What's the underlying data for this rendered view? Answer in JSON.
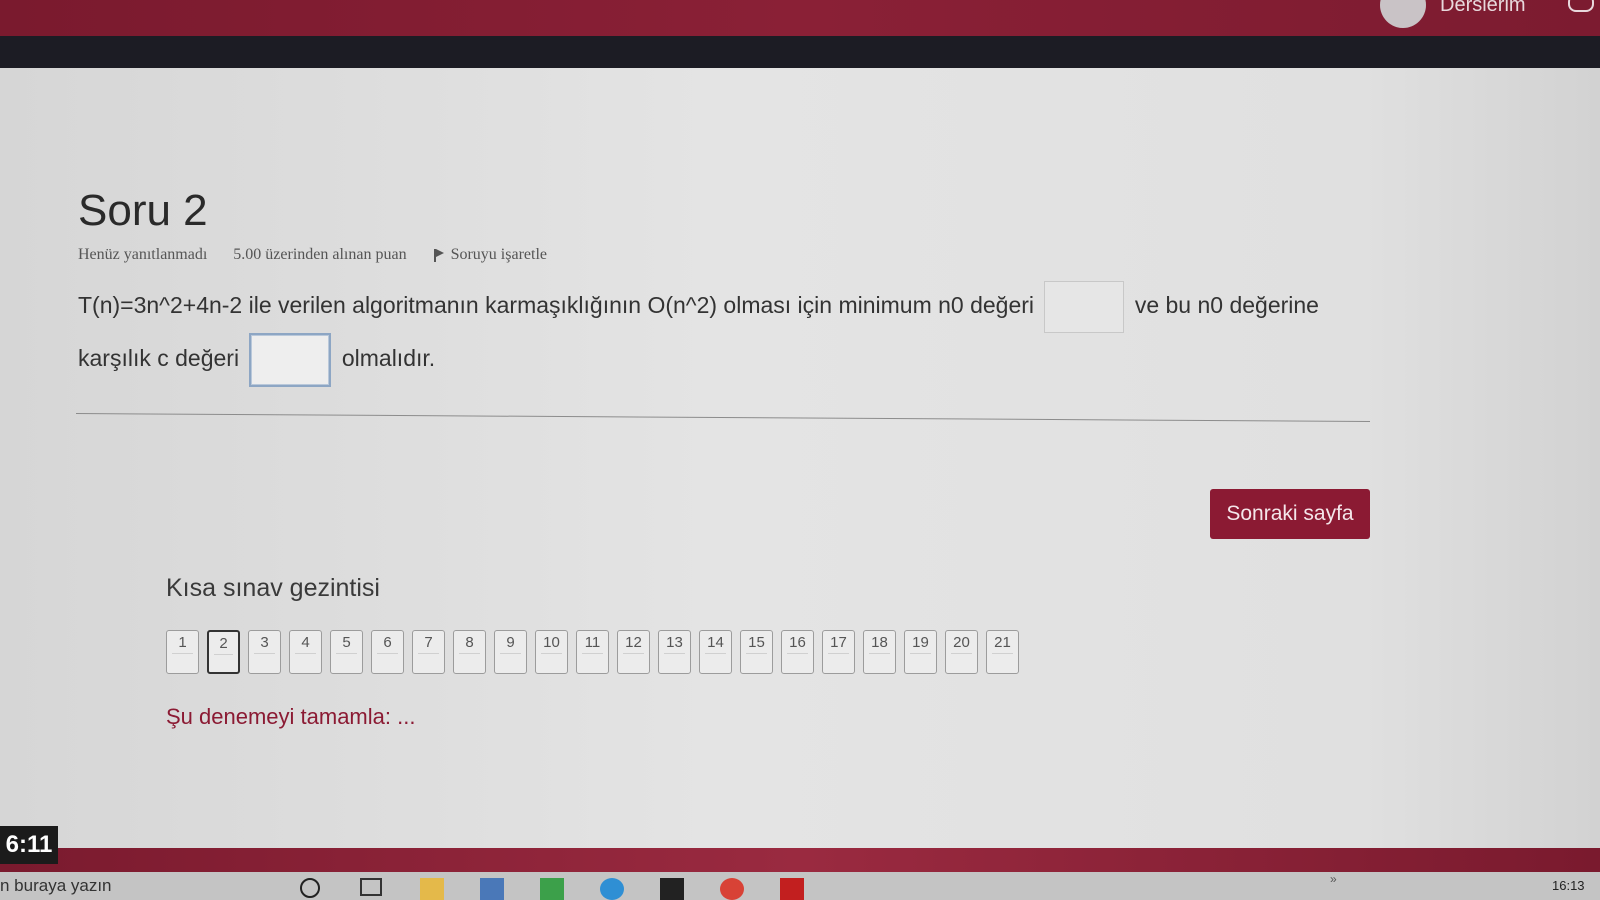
{
  "header": {
    "user_name": "Derslerim"
  },
  "question": {
    "title": "Soru 2",
    "status": "Henüz yanıtlanmadı",
    "points": "5.00 üzerinden alınan puan",
    "flag_label": "Soruyu işaretle",
    "text_part1": "T(n)=3n^2+4n-2 ile verilen algoritmanın karmaşıklığının O(n^2) olması için minimum n0 değeri",
    "text_part2": "ve bu n0 değerine karşılık c değeri",
    "text_part3": "olmalıdır.",
    "blank1_value": "",
    "blank2_value": ""
  },
  "actions": {
    "next_page": "Sonraki sayfa"
  },
  "navigation": {
    "title": "Kısa sınav gezintisi",
    "current": 2,
    "buttons": [
      "1",
      "2",
      "3",
      "4",
      "5",
      "6",
      "7",
      "8",
      "9",
      "10",
      "11",
      "12",
      "13",
      "14",
      "15",
      "16",
      "17",
      "18",
      "19",
      "20",
      "21"
    ],
    "finish_link": "Şu denemeyi tamamla: ..."
  },
  "timer": {
    "text": "6:11"
  },
  "taskbar": {
    "search_text": "n buraya yazın",
    "chevron": "»",
    "clock": "16:13"
  },
  "colors": {
    "brand": "#8b1a33",
    "header_dark": "#1c1c24"
  }
}
